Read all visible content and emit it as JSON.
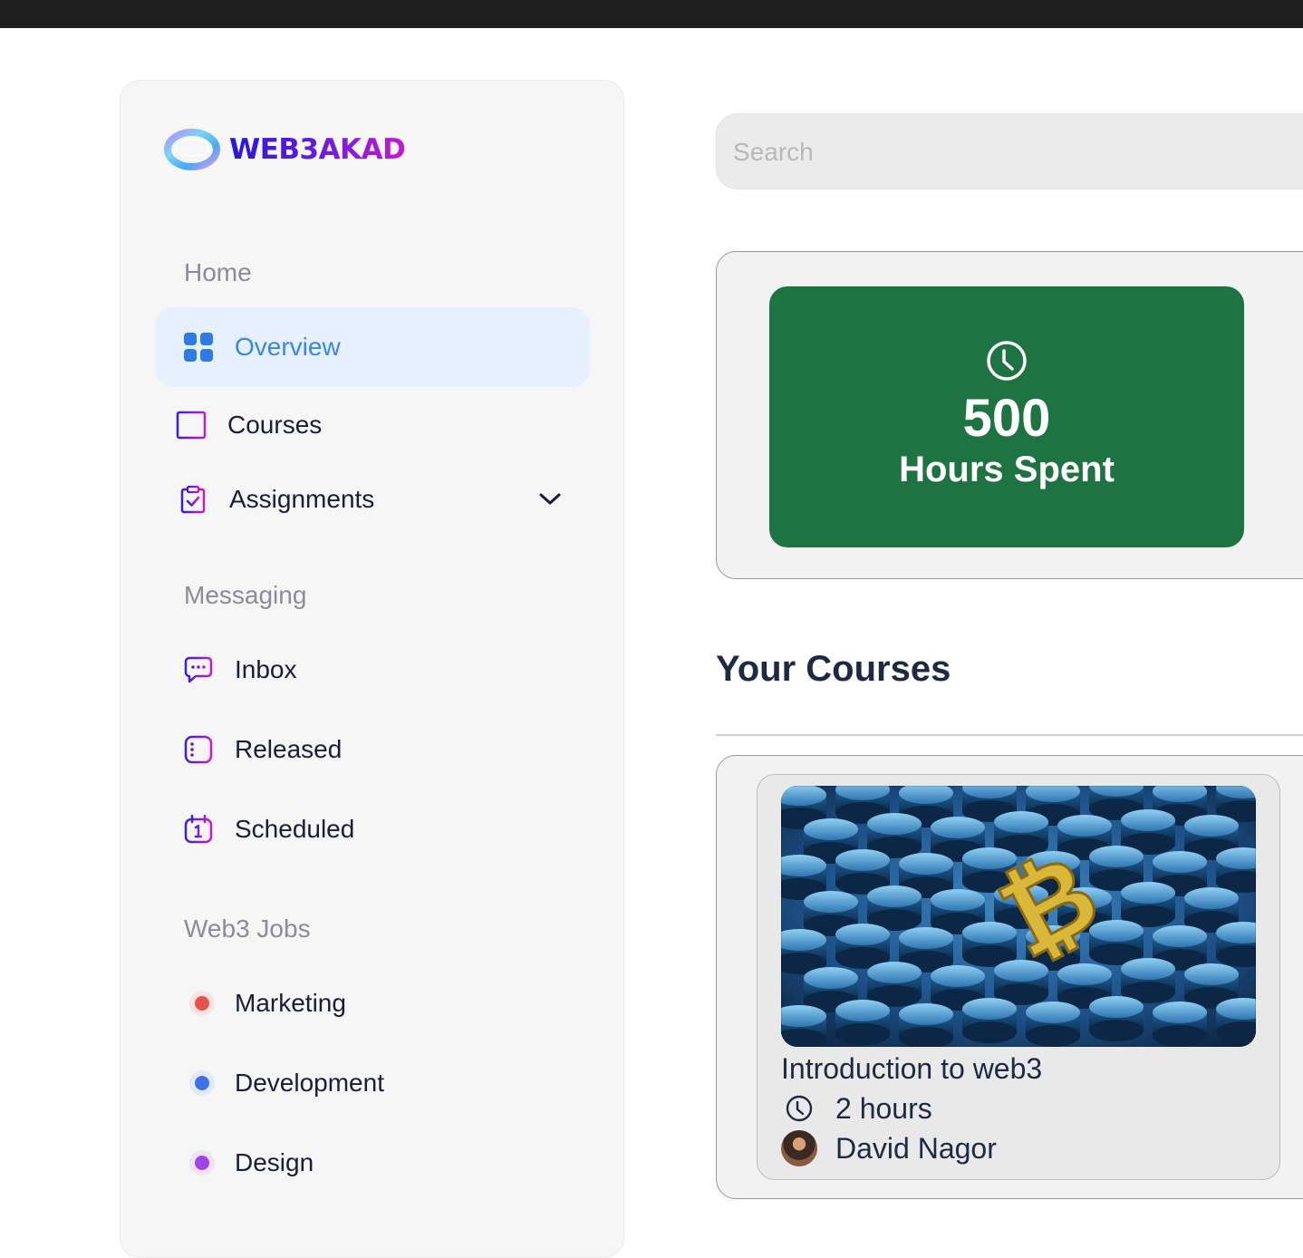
{
  "app": {
    "brand": "WEB3AKAD",
    "colors": {
      "active_bg": "#e6f0fe",
      "active_text": "#3a86e8",
      "stat_card": "#1d7442",
      "brand_start": "#2a16d6",
      "brand_end": "#c41ad0"
    }
  },
  "sidebar": {
    "sections": [
      {
        "label": "Home"
      },
      {
        "label": "Messaging"
      },
      {
        "label": "Web3 Jobs"
      }
    ],
    "home_items": [
      {
        "label": "Overview",
        "icon": "grid-icon",
        "active": true
      },
      {
        "label": "Courses",
        "icon": "book-icon"
      },
      {
        "label": "Assignments",
        "icon": "clipboard-check-icon",
        "expandable": true
      }
    ],
    "messaging_items": [
      {
        "label": "Inbox",
        "icon": "chat-icon"
      },
      {
        "label": "Released",
        "icon": "list-icon"
      },
      {
        "label": "Scheduled",
        "icon": "calendar-icon"
      }
    ],
    "jobs_items": [
      {
        "label": "Marketing",
        "dot_color": "#e5534b"
      },
      {
        "label": "Development",
        "dot_color": "#3b73e6"
      },
      {
        "label": "Design",
        "dot_color": "#a146e6"
      }
    ]
  },
  "search": {
    "placeholder": "Search",
    "value": ""
  },
  "stats": {
    "value": "500",
    "label": "Hours Spent",
    "icon": "clock-icon"
  },
  "courses_section": {
    "title": "Your Courses",
    "courses": [
      {
        "title": "Introduction to web3",
        "duration": "2 hours",
        "instructor": "David Nagor",
        "image": "bitcoin-coins-image"
      }
    ]
  }
}
